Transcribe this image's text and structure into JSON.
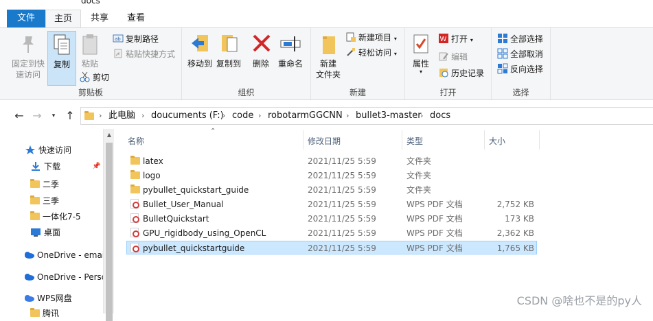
{
  "window": {
    "title": "docs"
  },
  "tabs": {
    "file": "文件",
    "home": "主页",
    "share": "共享",
    "view": "查看"
  },
  "ribbon": {
    "clipboard": {
      "label": "剪贴板",
      "pin": "固定到快\n速访问",
      "copy": "复制",
      "paste": "粘贴",
      "copy_path": "复制路径",
      "paste_shortcut": "粘贴快捷方式",
      "cut": "剪切"
    },
    "organize": {
      "label": "组织",
      "move_to": "移动到",
      "copy_to": "复制到",
      "delete": "删除",
      "rename": "重命名"
    },
    "new": {
      "label": "新建",
      "new_folder": "新建\n文件夹",
      "new_item": "新建项目",
      "easy_access": "轻松访问"
    },
    "open": {
      "label": "打开",
      "properties": "属性",
      "open": "打开",
      "edit": "编辑",
      "history": "历史记录"
    },
    "select": {
      "label": "选择",
      "select_all": "全部选择",
      "select_none": "全部取消",
      "invert": "反向选择"
    }
  },
  "address": {
    "crumbs": [
      "此电脑",
      "doucuments (F:)",
      "code",
      "robotarmGGCNN",
      "bullet3-master",
      "docs"
    ]
  },
  "navpane": {
    "items": [
      {
        "label": "快速访问",
        "icon": "star-icon"
      },
      {
        "label": "下载",
        "icon": "download-icon"
      },
      {
        "label": "二季",
        "icon": "folder-icon"
      },
      {
        "label": "三季",
        "icon": "folder-icon"
      },
      {
        "label": "一体化7-5",
        "icon": "folder-icon"
      },
      {
        "label": "桌面",
        "icon": "desktop-icon"
      },
      {
        "label": "OneDrive - emai",
        "icon": "cloud-icon"
      },
      {
        "label": "OneDrive - Perso",
        "icon": "cloud-icon"
      },
      {
        "label": "WPS网盘",
        "icon": "cloud-icon"
      },
      {
        "label": "腾讯",
        "icon": "folder-icon"
      }
    ]
  },
  "filelist": {
    "columns": {
      "name": "名称",
      "date": "修改日期",
      "type": "类型",
      "size": "大小"
    },
    "rows": [
      {
        "name": "latex",
        "date": "2021/11/25 5:59",
        "type": "文件夹",
        "size": "",
        "kind": "folder"
      },
      {
        "name": "logo",
        "date": "2021/11/25 5:59",
        "type": "文件夹",
        "size": "",
        "kind": "folder"
      },
      {
        "name": "pybullet_quickstart_guide",
        "date": "2021/11/25 5:59",
        "type": "文件夹",
        "size": "",
        "kind": "folder"
      },
      {
        "name": "Bullet_User_Manual",
        "date": "2021/11/25 5:59",
        "type": "WPS PDF 文档",
        "size": "2,752 KB",
        "kind": "pdf"
      },
      {
        "name": "BulletQuickstart",
        "date": "2021/11/25 5:59",
        "type": "WPS PDF 文档",
        "size": "173 KB",
        "kind": "pdf"
      },
      {
        "name": "GPU_rigidbody_using_OpenCL",
        "date": "2021/11/25 5:59",
        "type": "WPS PDF 文档",
        "size": "2,362 KB",
        "kind": "pdf"
      },
      {
        "name": "pybullet_quickstartguide",
        "date": "2021/11/25 5:59",
        "type": "WPS PDF 文档",
        "size": "1,765 KB",
        "kind": "pdf",
        "selected": true
      }
    ]
  },
  "watermark": "CSDN @啥也不是的py人"
}
